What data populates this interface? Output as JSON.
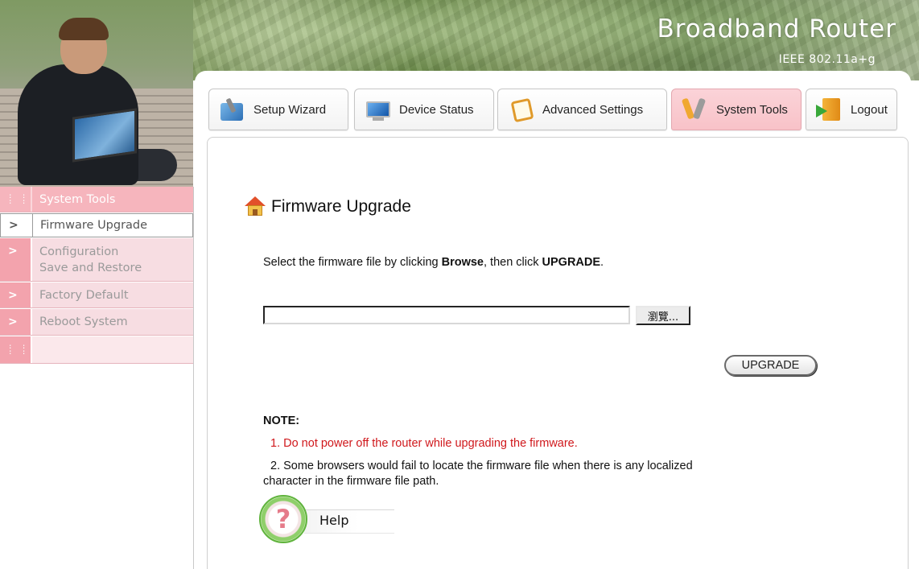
{
  "brand": {
    "title": "Broadband Router",
    "subtitle": "IEEE 802.11a+g"
  },
  "tabs": [
    {
      "label": "Setup Wizard",
      "icon": "wizard-icon",
      "selected": false
    },
    {
      "label": "Device Status",
      "icon": "monitor-icon",
      "selected": false
    },
    {
      "label": "Advanced Settings",
      "icon": "document-icon",
      "selected": false
    },
    {
      "label": "System Tools",
      "icon": "tools-icon",
      "selected": true
    },
    {
      "label": "Logout",
      "icon": "logout-door-icon",
      "selected": false
    }
  ],
  "sidebar": {
    "header": "System Tools",
    "items": [
      {
        "label": "Firmware Upgrade",
        "active": true
      },
      {
        "label_line1": "Configuration",
        "label_line2": "Save and Restore",
        "active": false
      },
      {
        "label": "Factory Default",
        "active": false
      },
      {
        "label": "Reboot System",
        "active": false
      }
    ]
  },
  "main": {
    "title": "Firmware Upgrade",
    "instruction_pre": "Select the firmware file by clicking ",
    "instruction_browse": "Browse",
    "instruction_mid": ", then click ",
    "instruction_upgrade": "UPGRADE",
    "instruction_post": ".",
    "file_value": "",
    "browse_button": "瀏覽...",
    "upgrade_button": "UPGRADE",
    "note_title": "NOTE:",
    "note1": "1. Do not power off the router while upgrading the firmware.",
    "note2_line1": "2. Some browsers would fail to locate the firmware file when there is any localized",
    "note2_line2": "character in the firmware file path.",
    "help_label": "Help"
  },
  "colors": {
    "menu_pink": "#f6b5bd",
    "selected_tab": "#f8c2c8",
    "warning_red": "#d0181c"
  }
}
